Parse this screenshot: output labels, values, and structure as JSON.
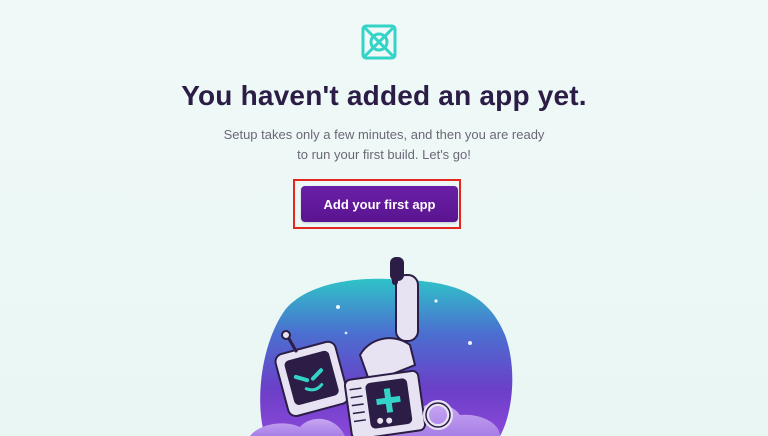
{
  "page": {
    "heading": "You haven't added an app yet.",
    "subtext_line1": "Setup takes only a few minutes, and then you are ready",
    "subtext_line2": "to run your first build. Let's go!",
    "cta_label": "Add your first app"
  },
  "colors": {
    "brand_teal": "#34d3c8",
    "brand_purple": "#5a148f",
    "heading_color": "#2b1d45",
    "highlight_border": "#e5261e"
  },
  "icons": {
    "logo": "bitrise-logo-icon",
    "illustration": "robot-illustration"
  }
}
